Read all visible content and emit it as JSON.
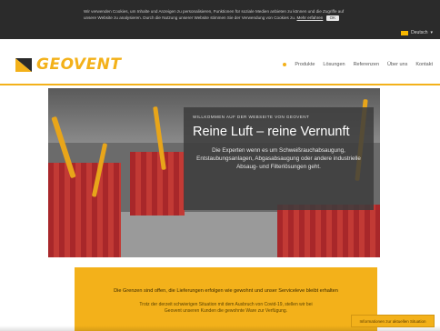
{
  "cookie_bar": {
    "text": "Wir verwenden Cookies, um Inhalte und Anzeigen zu personalisieren, Funktionen für soziale Medien anbieten zu können und die Zugriffe auf unsere Website zu analysieren. Durch die Nutzung unserer Website stimmen Sie der Verwendung von Cookies zu.",
    "link_label": "Mehr erfahren",
    "ok_label": "OK"
  },
  "language": {
    "label": "Deutsch"
  },
  "header": {
    "logo_text": "GEOVENT",
    "nav": [
      {
        "label": "Produkte"
      },
      {
        "label": "Lösungen"
      },
      {
        "label": "Referenzen"
      },
      {
        "label": "Über uns"
      },
      {
        "label": "Kontakt"
      }
    ]
  },
  "hero": {
    "kicker": "WILLKOMMEN AUF DER WEBSEITE VON GEOVENT",
    "title": "Reine Luft – reine Vernunft",
    "description": "Die Experten wenn es um Schweißrauchabsaugung, Entstaubungsanlagen, Abgasabsaugung oder andere industrielle Absaug- und Filterlösungen geht."
  },
  "banner": {
    "title": "Die Grenzen sind offen, die Lieferungen erfolgen wie gewohnt und unser Serviceleve bleibt erhalten",
    "text": "Trotz der derzeit schwierigen Situation mit dem Ausbruch von Covid-19, stellen wir bei Geovent unseren Kunden die gewohnte Ware zur Verfügung."
  },
  "floating_tab": {
    "label": "Informationen zur aktuellen Situation"
  },
  "colors": {
    "brand_yellow": "#f3b11a",
    "dark_bar": "#2b2b2b",
    "curtain_red": "#b52f2f"
  }
}
